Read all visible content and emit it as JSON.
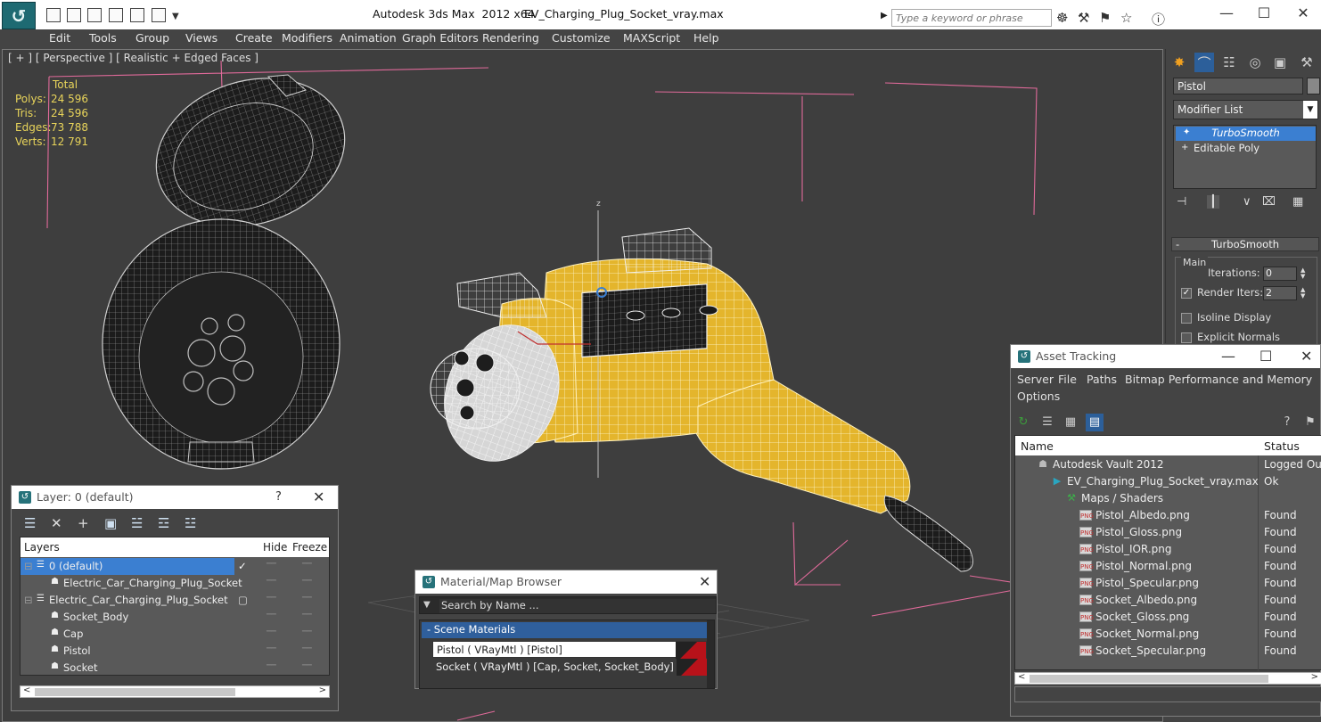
{
  "window": {
    "app_title": "Autodesk 3ds Max  2012 x64",
    "file_title": "EV_Charging_Plug_Socket_vray.max",
    "search_placeholder": "Type a keyword or phrase"
  },
  "menu": [
    "Edit",
    "Tools",
    "Group",
    "Views",
    "Create",
    "Modifiers",
    "Animation",
    "Graph Editors",
    "Rendering",
    "Customize",
    "MAXScript",
    "Help"
  ],
  "viewport": {
    "label": "[ + ] [ Perspective ] [ Realistic + Edged Faces ]",
    "stats": {
      "total_label": "Total",
      "rows": [
        {
          "k": "Polys:",
          "v": "24 596"
        },
        {
          "k": "Tris:",
          "v": "24 596"
        },
        {
          "k": "Edges:",
          "v": "73 788"
        },
        {
          "k": "Verts:",
          "v": "12 791"
        }
      ]
    },
    "axis_label": "z"
  },
  "command_panel": {
    "object_name": "Pistol",
    "modifier_list": "Modifier List",
    "stack": [
      "TurboSmooth",
      "Editable Poly"
    ],
    "rollout_title": "TurboSmooth",
    "group_main": "Main",
    "iterations_label": "Iterations:",
    "iterations_value": "0",
    "render_iters_label": "Render Iters:",
    "render_iters_value": "2",
    "isoline_label": "Isoline Display",
    "explicit_label": "Explicit Normals"
  },
  "layer_dialog": {
    "title": "Layer: 0 (default)",
    "help": "?",
    "col_layers": "Layers",
    "col_hide": "Hide",
    "col_freeze": "Freeze",
    "rows": [
      {
        "name": "0 (default)",
        "indent": 32,
        "selected": true
      },
      {
        "name": "Electric_Car_Charging_Plug_Socket",
        "indent": 48,
        "selected": false
      },
      {
        "name": "Electric_Car_Charging_Plug_Socket",
        "indent": 32,
        "selected": false
      },
      {
        "name": "Socket_Body",
        "indent": 48,
        "selected": false
      },
      {
        "name": "Cap",
        "indent": 48,
        "selected": false
      },
      {
        "name": "Pistol",
        "indent": 48,
        "selected": false
      },
      {
        "name": "Socket",
        "indent": 48,
        "selected": false
      }
    ]
  },
  "material_browser": {
    "title": "Material/Map Browser",
    "search_placeholder": "Search by Name ...",
    "group": "- Scene Materials",
    "items": [
      "Pistol  ( VRayMtl )  [Pistol]",
      "Socket  ( VRayMtl )  [Cap, Socket, Socket_Body]"
    ]
  },
  "asset_tracking": {
    "title": "Asset Tracking",
    "menu": [
      "Server",
      "File",
      "Paths",
      "Bitmap Performance and Memory",
      "Options"
    ],
    "col_name": "Name",
    "col_status": "Status",
    "rows": [
      {
        "name": "Autodesk Vault 2012",
        "status": "Logged Out",
        "type": "vault"
      },
      {
        "name": "EV_Charging_Plug_Socket_vray.max",
        "status": "Ok",
        "type": "max"
      },
      {
        "name": "Maps / Shaders",
        "status": "",
        "type": "maps"
      },
      {
        "name": "Pistol_Albedo.png",
        "status": "Found",
        "type": "png"
      },
      {
        "name": "Pistol_Gloss.png",
        "status": "Found",
        "type": "png"
      },
      {
        "name": "Pistol_IOR.png",
        "status": "Found",
        "type": "png"
      },
      {
        "name": "Pistol_Normal.png",
        "status": "Found",
        "type": "png"
      },
      {
        "name": "Pistol_Specular.png",
        "status": "Found",
        "type": "png"
      },
      {
        "name": "Socket_Albedo.png",
        "status": "Found",
        "type": "png"
      },
      {
        "name": "Socket_Gloss.png",
        "status": "Found",
        "type": "png"
      },
      {
        "name": "Socket_Normal.png",
        "status": "Found",
        "type": "png"
      },
      {
        "name": "Socket_Specular.png",
        "status": "Found",
        "type": "png"
      }
    ]
  },
  "colors": {
    "viewport_bg": "#3e3e3e",
    "plug_yellow": "#e4b52c",
    "selection_blue": "#3b7fd1",
    "stats_yellow": "#e8d45a",
    "bbox_pink": "#e06a9a"
  }
}
